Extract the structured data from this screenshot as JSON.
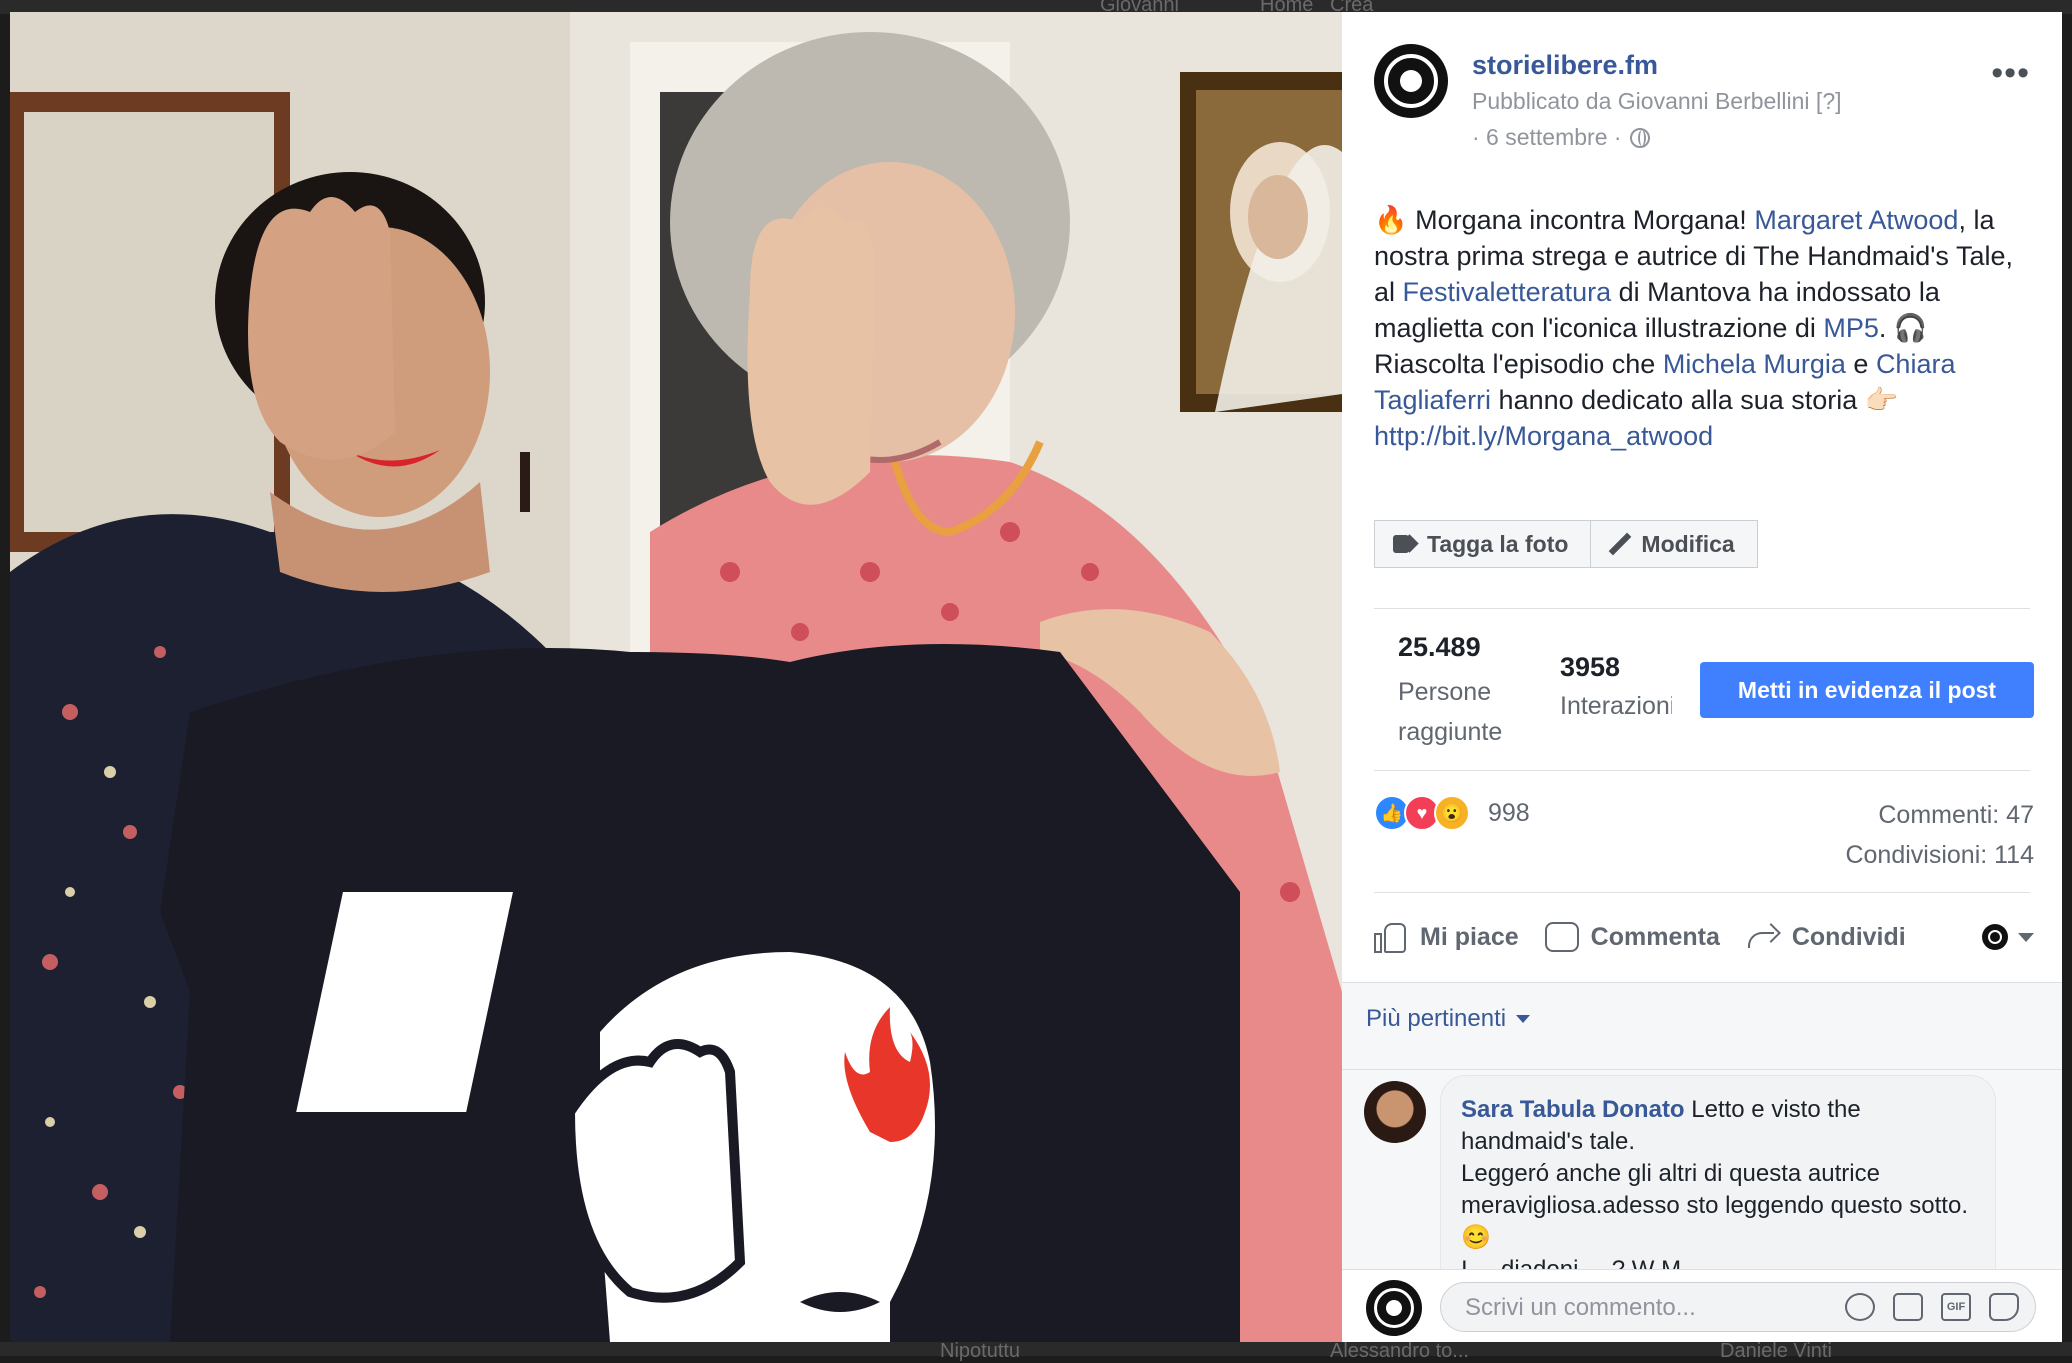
{
  "backdrop": {
    "top_labels": [
      "Giovanni",
      "Home",
      "Crea"
    ],
    "bottom_labels": [
      "Nipotuttu",
      "Alessandro to...",
      "Daniele Vinti"
    ]
  },
  "photo": {
    "description_alt": "",
    "shirt_colors": {
      "shirt": "#191a24",
      "face": "#ffffff",
      "flame": "#e8372a"
    }
  },
  "post": {
    "page_name": "storielibere.fm",
    "published_by": "Pubblicato da Giovanni Berbellini [?]",
    "date": "· 6 settembre ·",
    "more_icon": "more-icon",
    "text": {
      "fire_emoji": "🔥",
      "t1": " Morgana incontra Morgana! ",
      "l1": "Margaret Atwood",
      "t2": ", la nostra prima strega e autrice di The Handmaid's Tale, al ",
      "l2": "Festivaletteratura",
      "t3": " di Mantova ha indossato la maglietta con l'iconica illustrazione di ",
      "l3": "MP5",
      "t4": ". 🎧 Riascolta l'episodio che ",
      "l4": "Michela Murgia",
      "t5": " e ",
      "l5": "Chiara Tagliaferri",
      "t6": " hanno dedicato alla sua storia 👉🏻 ",
      "l6": "http://bit.ly/Morgana_atwood"
    },
    "tag_button": "Tagga la foto",
    "edit_button": "Modifica",
    "reach_value": "25.489",
    "reach_label": "Persone raggiunte",
    "engagement_value": "3958",
    "engagement_label": "Interazioni",
    "boost_button": "Metti in evidenza il post",
    "reactions_count": "998",
    "comments_count": "Commenti: 47",
    "shares_count": "Condivisioni: 114",
    "actions": {
      "like": "Mi piace",
      "comment": "Commenta",
      "share": "Condividi"
    }
  },
  "comments": {
    "sort_label": "Più pertinenti",
    "items": [
      {
        "author": "Sara Tabula Donato",
        "text_l1": " Letto e visto the handmaid's tale.",
        "text_l2": "Leggeró anche gli altri di questa autrice meravigliosa.adesso sto leggendo questo sotto. 😊",
        "text_l3": "I ... diadoni ... ? W M"
      }
    ]
  },
  "composer": {
    "placeholder": "Scrivi un commento...",
    "gif_label": "GIF"
  },
  "colors": {
    "link": "#385898",
    "boost": "#4080ff",
    "meta": "#90949c"
  }
}
